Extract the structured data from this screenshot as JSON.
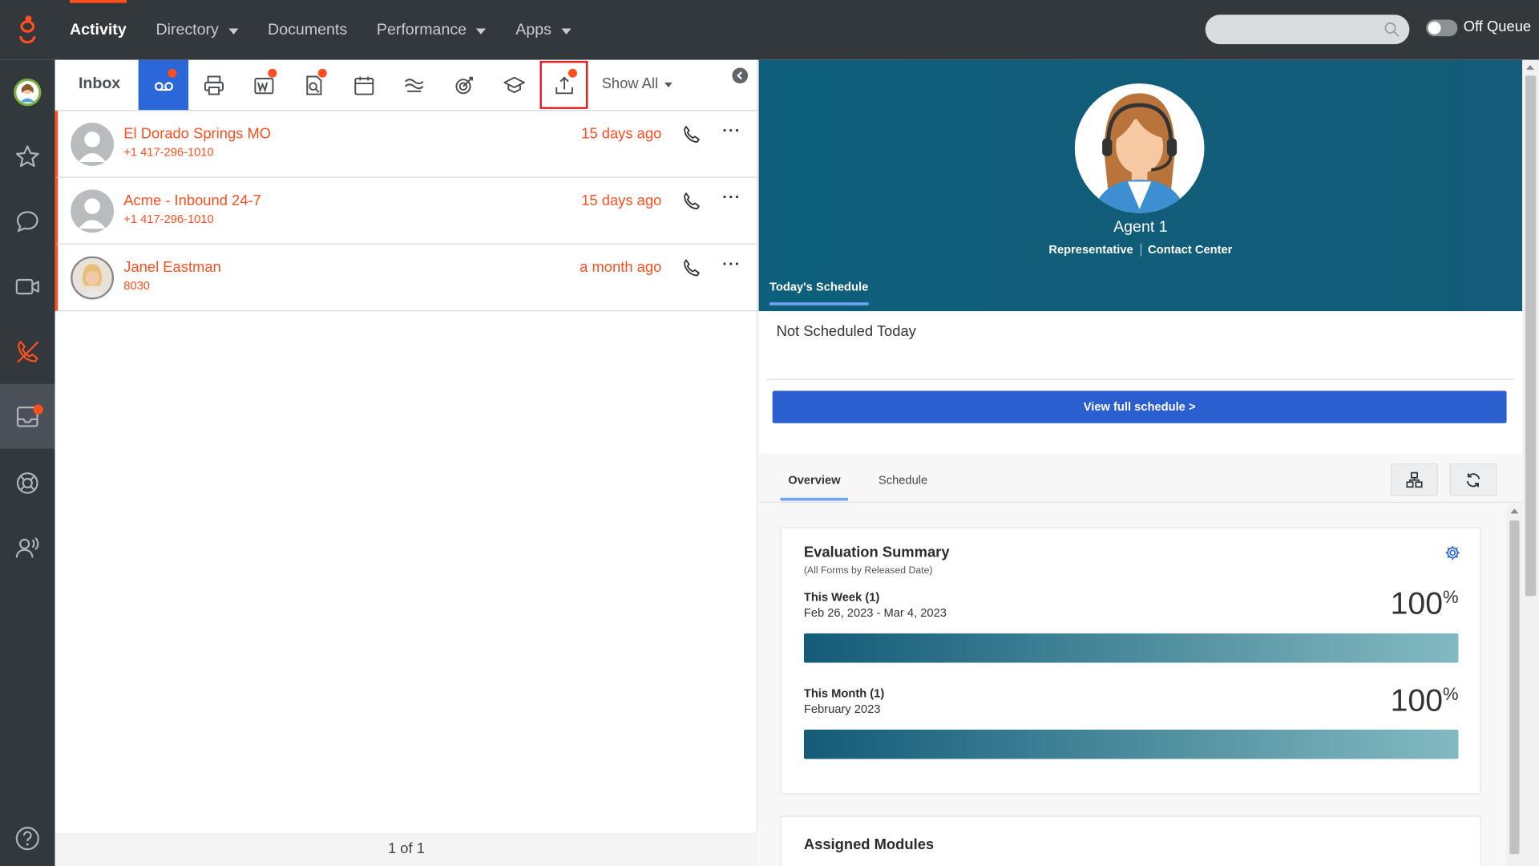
{
  "topbar": {
    "nav": [
      {
        "label": "Activity",
        "active": true,
        "dropdown": false
      },
      {
        "label": "Directory",
        "active": false,
        "dropdown": true
      },
      {
        "label": "Documents",
        "active": false,
        "dropdown": false
      },
      {
        "label": "Performance",
        "active": false,
        "dropdown": true
      },
      {
        "label": "Apps",
        "active": false,
        "dropdown": true
      }
    ],
    "search_placeholder": "",
    "queue_label": "Off Queue"
  },
  "rail": {
    "items": [
      "avatar",
      "favorites-star-icon",
      "chat-bubble-icon",
      "video-icon",
      "phone-off-icon",
      "inbox-icon",
      "help-lifebuoy-icon",
      "people-speaking-icon",
      "help-question-icon"
    ],
    "active": "inbox-icon"
  },
  "inbox": {
    "title": "Inbox",
    "toolbar": [
      "voicemail-icon",
      "fax-printer-icon",
      "workitem-icon",
      "review-icon",
      "calendar-icon",
      "transcript-icon",
      "gamification-icon",
      "learning-icon",
      "export-upload-icon"
    ],
    "show_all_label": "Show All",
    "rows": [
      {
        "name": "El Dorado Springs MO",
        "sub": "+1 417-296-1010",
        "time": "15 days ago"
      },
      {
        "name": "Acme - Inbound 24-7",
        "sub": "+1 417-296-1010",
        "time": "15 days ago"
      },
      {
        "name": "Janel Eastman",
        "sub": "8030",
        "time": "a month ago"
      }
    ],
    "pager": "1 of 1"
  },
  "profile": {
    "name": "Agent 1",
    "role": "Representative",
    "department": "Contact Center",
    "schedule_tab": "Today's Schedule",
    "schedule_status": "Not Scheduled Today",
    "view_schedule_label": "View full schedule >"
  },
  "dashboard": {
    "tabs": [
      "Overview",
      "Schedule"
    ],
    "active_tab": "Overview",
    "evaluation": {
      "title": "Evaluation Summary",
      "subtitle": "(All Forms by Released Date)",
      "week_label": "This Week (1)",
      "week_dates": "Feb 26, 2023 - Mar 4, 2023",
      "week_pct": "100",
      "week_fill": 1.0,
      "month_label": "This Month (1)",
      "month_dates": "February 2023",
      "month_pct": "100",
      "month_fill": 1.0,
      "pct_symbol": "%"
    },
    "modules_title": "Assigned Modules"
  },
  "colors": {
    "accent": "#ff4f1f",
    "topbar": "#33383d",
    "profile_bg": "#0e5f7c",
    "primary_button": "#2b5fd0"
  }
}
